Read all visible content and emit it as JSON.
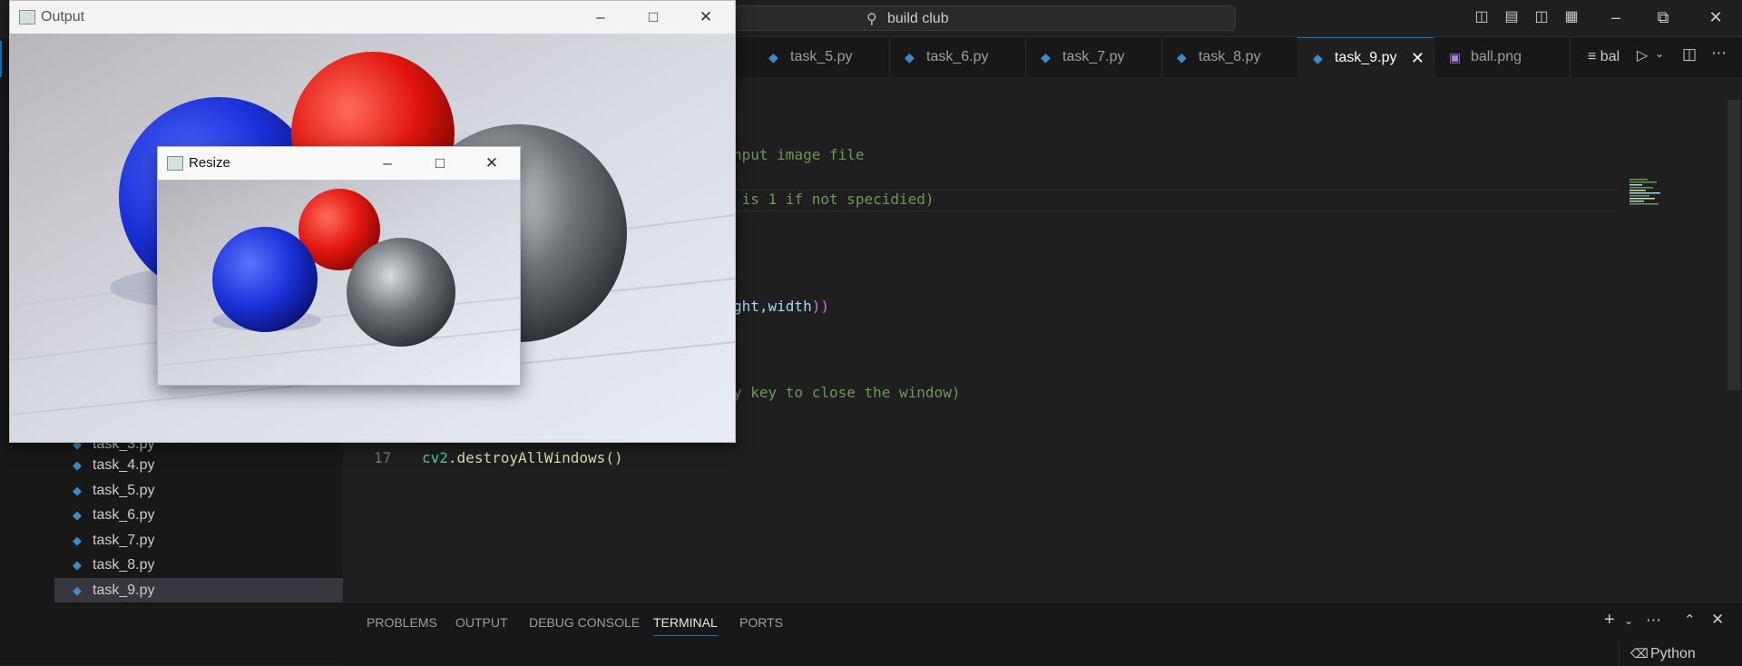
{
  "titlebar": {
    "search_text": "build club",
    "icons": [
      "toggle-primary-sidebar-icon",
      "toggle-panel-icon",
      "toggle-secondary-sidebar-icon",
      "customize-layout-icon"
    ],
    "window_controls": [
      "minimize-icon",
      "restore-icon",
      "close-icon"
    ]
  },
  "sidebar": {
    "files": [
      {
        "label": "task_3.py"
      },
      {
        "label": "task_4.py"
      },
      {
        "label": "task_5.py"
      },
      {
        "label": "task_6.py"
      },
      {
        "label": "task_7.py"
      },
      {
        "label": "task_8.py"
      },
      {
        "label": "task_9.py",
        "selected": true
      }
    ]
  },
  "tabs": [
    {
      "label": "task_5.py"
    },
    {
      "label": "task_6.py"
    },
    {
      "label": "task_7.py"
    },
    {
      "label": "task_8.py"
    },
    {
      "label": "task_9.py",
      "active": true
    },
    {
      "label": "ball.png"
    }
  ],
  "tab_overflow_label": "bal",
  "editor": {
    "visible_fragments": {
      "line_a": "nput image file",
      "line_b": " is 1 if not specidied)",
      "line_c_prefix": "ght,",
      "line_c_var": "width",
      "line_c_suffix": "))",
      "line_d": "y key to close the window)"
    },
    "line17": {
      "number": "17",
      "module": "cv2",
      "dot": ".",
      "func": "destroyAllWindows",
      "parens": "()"
    }
  },
  "panel": {
    "tabs": [
      "PROBLEMS",
      "OUTPUT",
      "DEBUG CONSOLE",
      "TERMINAL",
      "PORTS"
    ],
    "active_tab": "TERMINAL",
    "terminal_label": "Python"
  },
  "windows": {
    "output": {
      "title": "Output"
    },
    "resize": {
      "title": "Resize"
    }
  },
  "colors": {
    "accent": "#0078d4",
    "ball_blue": "#1a2fd6",
    "ball_red": "#e0140e",
    "ball_steel": "#4a4f52"
  }
}
